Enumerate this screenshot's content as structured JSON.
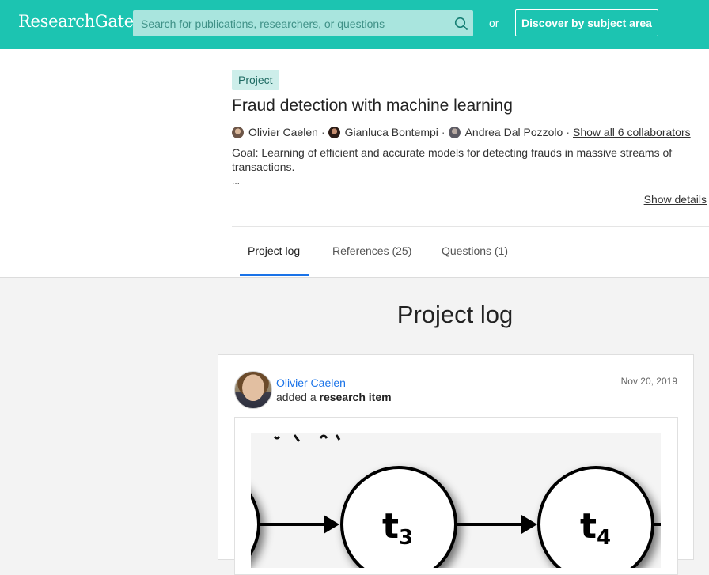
{
  "header": {
    "logo": "ResearchGate",
    "search_placeholder": "Search for publications, researchers, or questions",
    "or_label": "or",
    "discover_label": "Discover by subject area"
  },
  "project": {
    "badge": "Project",
    "title": "Fraud detection with machine learning",
    "collaborators": [
      {
        "name": "Olivier Caelen"
      },
      {
        "name": "Gianluca Bontempi"
      },
      {
        "name": "Andrea Dal Pozzolo"
      }
    ],
    "separator": "·",
    "show_all_label": "Show all 6 collaborators",
    "goal": "Goal: Learning of efficient and accurate models for detecting frauds in massive streams of transactions.",
    "ellipsis": "...",
    "show_details_label": "Show details"
  },
  "tabs": [
    {
      "label": "Project log",
      "active": true
    },
    {
      "label": "References (25)",
      "active": false
    },
    {
      "label": "Questions (1)",
      "active": false
    }
  ],
  "log": {
    "heading": "Project log",
    "entry": {
      "author": "Olivier Caelen",
      "action_prefix": "added a",
      "action_object": "research item",
      "date": "Nov 20, 2019",
      "image_nodes": [
        "t",
        "t"
      ],
      "image_subscripts": [
        "3",
        "4"
      ]
    }
  },
  "colors": {
    "brand_teal": "#1cc4b1",
    "link_blue": "#1a73e8",
    "badge_bg": "#cdeeea"
  }
}
